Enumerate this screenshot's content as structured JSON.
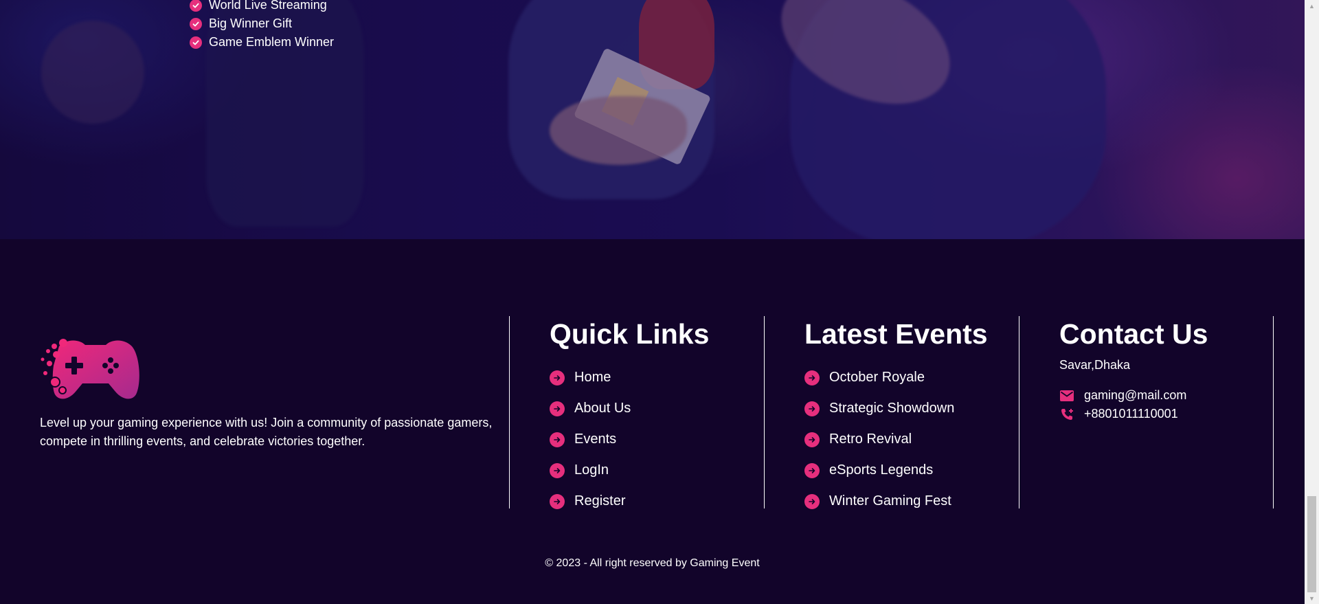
{
  "hero": {
    "features": [
      {
        "label": "World Live Streaming",
        "icon": "check-circle-icon"
      },
      {
        "label": "Big Winner Gift",
        "icon": "check-circle-icon"
      },
      {
        "label": "Game Emblem Winner",
        "icon": "check-circle-icon"
      }
    ]
  },
  "footer": {
    "logo_icon": "gamepad-icon",
    "tagline": "Level up your gaming experience with us! Join a community of passionate gamers, compete in thrilling events, and celebrate victories together.",
    "quick_links": {
      "title": "Quick Links",
      "items": [
        "Home",
        "About Us",
        "Events",
        "LogIn",
        "Register"
      ]
    },
    "latest_events": {
      "title": "Latest Events",
      "items": [
        "October Royale",
        "Strategic Showdown",
        "Retro Revival",
        "eSports Legends",
        "Winter Gaming Fest"
      ]
    },
    "contact": {
      "title": "Contact Us",
      "address": "Savar,Dhaka",
      "email": "gaming@mail.com",
      "phone": "+8801011110001"
    },
    "copyright": "© 2023 - All right reserved by Gaming Event"
  },
  "colors": {
    "accent": "#e62f7d",
    "background": "#12042a"
  }
}
